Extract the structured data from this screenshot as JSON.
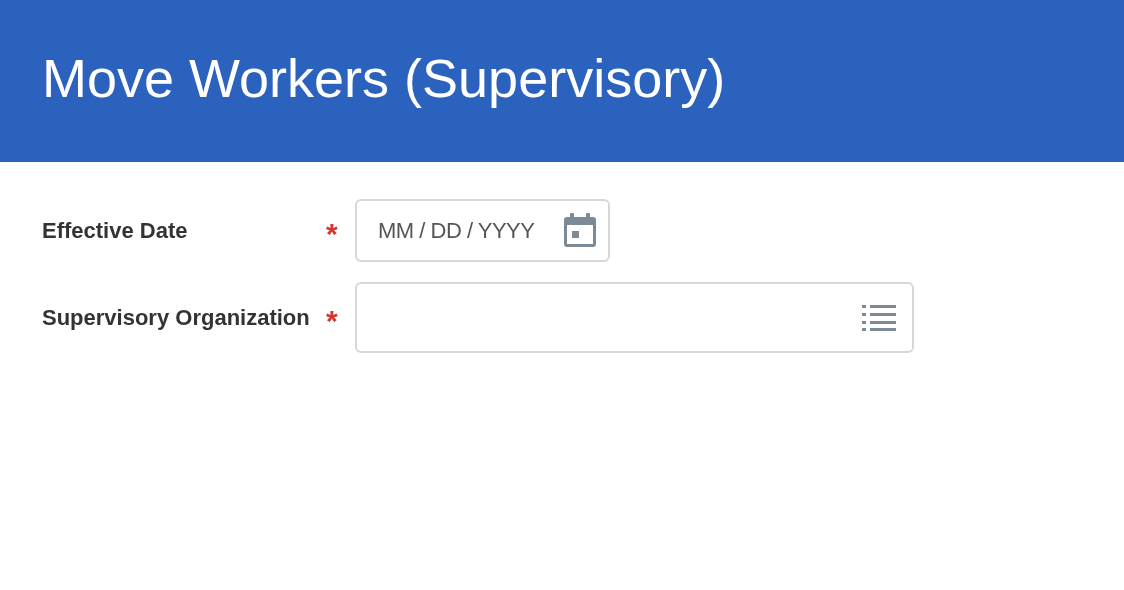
{
  "header": {
    "title": "Move Workers (Supervisory)"
  },
  "fields": [
    {
      "kind": "date",
      "label": "Effective Date",
      "required_mark": "*",
      "placeholder": "MM / DD / YYYY"
    },
    {
      "kind": "prompt",
      "label": "Supervisory Organization",
      "required_mark": "*"
    }
  ]
}
